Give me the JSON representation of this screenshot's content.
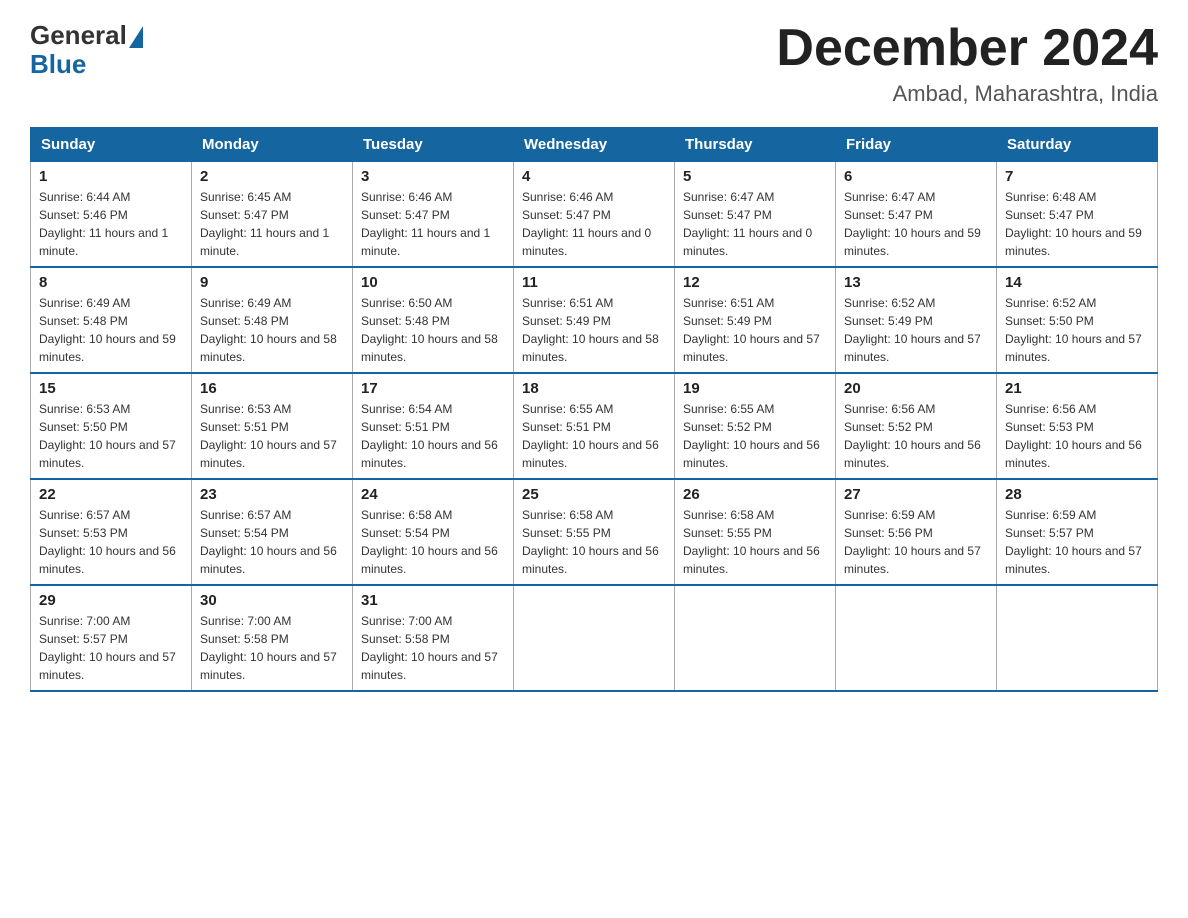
{
  "header": {
    "logo_general": "General",
    "logo_blue": "Blue",
    "title": "December 2024",
    "location": "Ambad, Maharashtra, India"
  },
  "days_of_week": [
    "Sunday",
    "Monday",
    "Tuesday",
    "Wednesday",
    "Thursday",
    "Friday",
    "Saturday"
  ],
  "weeks": [
    [
      {
        "day": "1",
        "sunrise": "6:44 AM",
        "sunset": "5:46 PM",
        "daylight": "11 hours and 1 minute."
      },
      {
        "day": "2",
        "sunrise": "6:45 AM",
        "sunset": "5:47 PM",
        "daylight": "11 hours and 1 minute."
      },
      {
        "day": "3",
        "sunrise": "6:46 AM",
        "sunset": "5:47 PM",
        "daylight": "11 hours and 1 minute."
      },
      {
        "day": "4",
        "sunrise": "6:46 AM",
        "sunset": "5:47 PM",
        "daylight": "11 hours and 0 minutes."
      },
      {
        "day": "5",
        "sunrise": "6:47 AM",
        "sunset": "5:47 PM",
        "daylight": "11 hours and 0 minutes."
      },
      {
        "day": "6",
        "sunrise": "6:47 AM",
        "sunset": "5:47 PM",
        "daylight": "10 hours and 59 minutes."
      },
      {
        "day": "7",
        "sunrise": "6:48 AM",
        "sunset": "5:47 PM",
        "daylight": "10 hours and 59 minutes."
      }
    ],
    [
      {
        "day": "8",
        "sunrise": "6:49 AM",
        "sunset": "5:48 PM",
        "daylight": "10 hours and 59 minutes."
      },
      {
        "day": "9",
        "sunrise": "6:49 AM",
        "sunset": "5:48 PM",
        "daylight": "10 hours and 58 minutes."
      },
      {
        "day": "10",
        "sunrise": "6:50 AM",
        "sunset": "5:48 PM",
        "daylight": "10 hours and 58 minutes."
      },
      {
        "day": "11",
        "sunrise": "6:51 AM",
        "sunset": "5:49 PM",
        "daylight": "10 hours and 58 minutes."
      },
      {
        "day": "12",
        "sunrise": "6:51 AM",
        "sunset": "5:49 PM",
        "daylight": "10 hours and 57 minutes."
      },
      {
        "day": "13",
        "sunrise": "6:52 AM",
        "sunset": "5:49 PM",
        "daylight": "10 hours and 57 minutes."
      },
      {
        "day": "14",
        "sunrise": "6:52 AM",
        "sunset": "5:50 PM",
        "daylight": "10 hours and 57 minutes."
      }
    ],
    [
      {
        "day": "15",
        "sunrise": "6:53 AM",
        "sunset": "5:50 PM",
        "daylight": "10 hours and 57 minutes."
      },
      {
        "day": "16",
        "sunrise": "6:53 AM",
        "sunset": "5:51 PM",
        "daylight": "10 hours and 57 minutes."
      },
      {
        "day": "17",
        "sunrise": "6:54 AM",
        "sunset": "5:51 PM",
        "daylight": "10 hours and 56 minutes."
      },
      {
        "day": "18",
        "sunrise": "6:55 AM",
        "sunset": "5:51 PM",
        "daylight": "10 hours and 56 minutes."
      },
      {
        "day": "19",
        "sunrise": "6:55 AM",
        "sunset": "5:52 PM",
        "daylight": "10 hours and 56 minutes."
      },
      {
        "day": "20",
        "sunrise": "6:56 AM",
        "sunset": "5:52 PM",
        "daylight": "10 hours and 56 minutes."
      },
      {
        "day": "21",
        "sunrise": "6:56 AM",
        "sunset": "5:53 PM",
        "daylight": "10 hours and 56 minutes."
      }
    ],
    [
      {
        "day": "22",
        "sunrise": "6:57 AM",
        "sunset": "5:53 PM",
        "daylight": "10 hours and 56 minutes."
      },
      {
        "day": "23",
        "sunrise": "6:57 AM",
        "sunset": "5:54 PM",
        "daylight": "10 hours and 56 minutes."
      },
      {
        "day": "24",
        "sunrise": "6:58 AM",
        "sunset": "5:54 PM",
        "daylight": "10 hours and 56 minutes."
      },
      {
        "day": "25",
        "sunrise": "6:58 AM",
        "sunset": "5:55 PM",
        "daylight": "10 hours and 56 minutes."
      },
      {
        "day": "26",
        "sunrise": "6:58 AM",
        "sunset": "5:55 PM",
        "daylight": "10 hours and 56 minutes."
      },
      {
        "day": "27",
        "sunrise": "6:59 AM",
        "sunset": "5:56 PM",
        "daylight": "10 hours and 57 minutes."
      },
      {
        "day": "28",
        "sunrise": "6:59 AM",
        "sunset": "5:57 PM",
        "daylight": "10 hours and 57 minutes."
      }
    ],
    [
      {
        "day": "29",
        "sunrise": "7:00 AM",
        "sunset": "5:57 PM",
        "daylight": "10 hours and 57 minutes."
      },
      {
        "day": "30",
        "sunrise": "7:00 AM",
        "sunset": "5:58 PM",
        "daylight": "10 hours and 57 minutes."
      },
      {
        "day": "31",
        "sunrise": "7:00 AM",
        "sunset": "5:58 PM",
        "daylight": "10 hours and 57 minutes."
      },
      null,
      null,
      null,
      null
    ]
  ]
}
